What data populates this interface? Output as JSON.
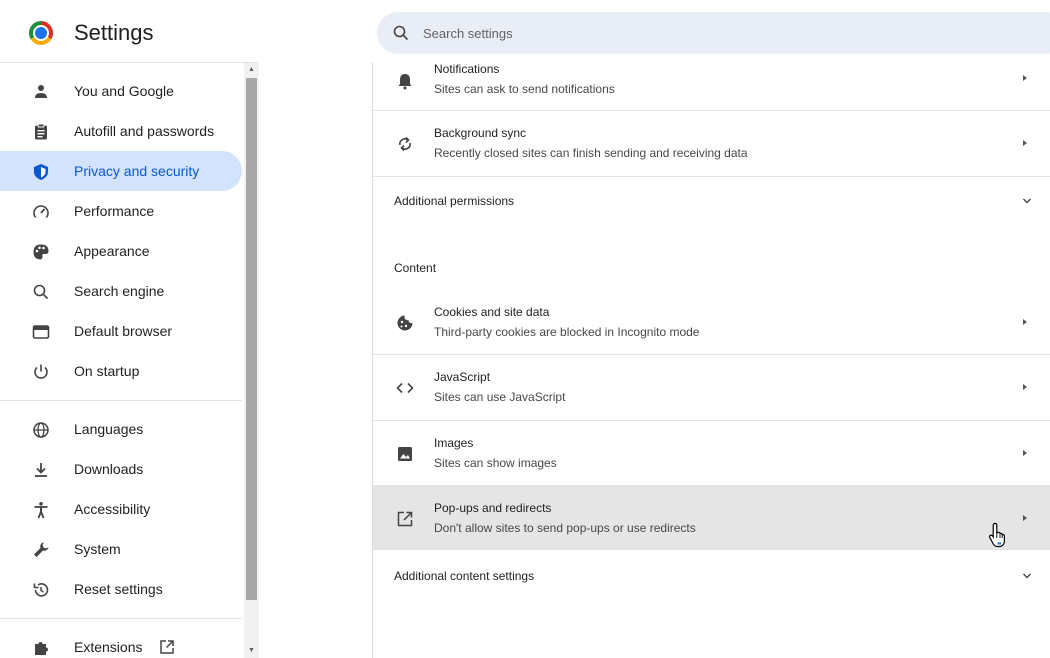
{
  "header": {
    "app_title": "Settings",
    "search_placeholder": "Search settings"
  },
  "sidebar": {
    "items": [
      {
        "label": "You and Google",
        "icon": "person-icon"
      },
      {
        "label": "Autofill and passwords",
        "icon": "clipboard-icon"
      },
      {
        "label": "Privacy and security",
        "icon": "shield-icon",
        "active": true
      },
      {
        "label": "Performance",
        "icon": "speedometer-icon"
      },
      {
        "label": "Appearance",
        "icon": "palette-icon"
      },
      {
        "label": "Search engine",
        "icon": "search-icon"
      },
      {
        "label": "Default browser",
        "icon": "browser-window-icon"
      },
      {
        "label": "On startup",
        "icon": "power-icon"
      },
      {
        "label": "Languages",
        "icon": "globe-icon"
      },
      {
        "label": "Downloads",
        "icon": "download-icon"
      },
      {
        "label": "Accessibility",
        "icon": "accessibility-icon"
      },
      {
        "label": "System",
        "icon": "wrench-icon"
      },
      {
        "label": "Reset settings",
        "icon": "reset-icon"
      },
      {
        "label": "Extensions",
        "icon": "puzzle-icon"
      }
    ]
  },
  "main": {
    "permissions": [
      {
        "title": "Notifications",
        "subtitle": "Sites can ask to send notifications",
        "icon": "bell-icon"
      },
      {
        "title": "Background sync",
        "subtitle": "Recently closed sites can finish sending and receiving data",
        "icon": "sync-icon"
      }
    ],
    "additional_permissions": "Additional permissions",
    "content_heading": "Content",
    "content": [
      {
        "title": "Cookies and site data",
        "subtitle": "Third-party cookies are blocked in Incognito mode",
        "icon": "cookie-icon"
      },
      {
        "title": "JavaScript",
        "subtitle": "Sites can use JavaScript",
        "icon": "code-icon"
      },
      {
        "title": "Images",
        "subtitle": "Sites can show images",
        "icon": "image-icon"
      },
      {
        "title": "Pop-ups and redirects",
        "subtitle": "Don't allow sites to send pop-ups or use redirects",
        "icon": "popup-icon",
        "hovered": true
      }
    ],
    "additional_content": "Additional content settings"
  },
  "colors": {
    "accent": "#0b57d0",
    "active_bg": "#d3e3fd",
    "search_bg": "#e9eef6",
    "hover_row": "#e5e5e5"
  }
}
